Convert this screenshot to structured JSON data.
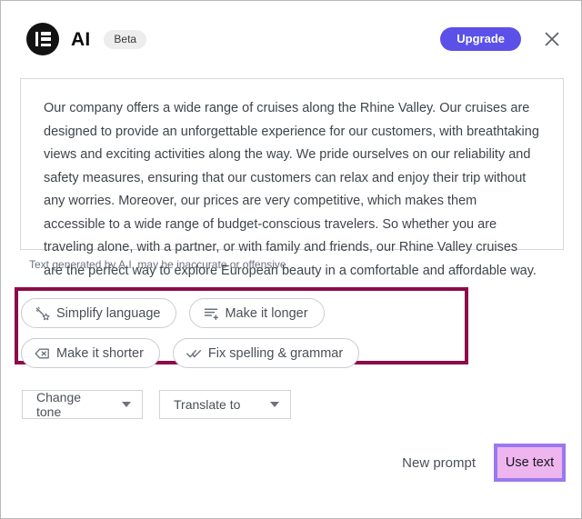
{
  "header": {
    "logo_icon": "elementor-logo-icon",
    "title": "AI",
    "badge": "Beta",
    "upgrade_label": "Upgrade",
    "close_icon": "close-icon"
  },
  "generated_text": {
    "body": "Our company offers a wide range of cruises along the Rhine Valley. Our cruises are designed to provide an unforgettable experience for our customers, with breathtaking views and exciting activities along the way. We pride ourselves on our reliability and safety measures, ensuring that our customers can relax and enjoy their trip without any worries. Moreover, our prices are very competitive, which makes them accessible to a wide range of budget-conscious travelers. So whether you are traveling alone, with a partner, or with family and friends, our Rhine Valley cruises are the perfect way to explore European beauty in a comfortable and affordable way.",
    "disclaimer": "Text generated by A.I. may be inaccurate or offensive."
  },
  "actions": {
    "chips": [
      {
        "label": "Simplify language",
        "icon": "magic-wand-icon"
      },
      {
        "label": "Make it longer",
        "icon": "add-lines-icon"
      },
      {
        "label": "Make it shorter",
        "icon": "backspace-icon"
      },
      {
        "label": "Fix spelling & grammar",
        "icon": "double-check-icon"
      }
    ],
    "highlight_color": "#8c0b48"
  },
  "dropdowns": [
    {
      "label": "Change tone",
      "icon": "chevron-down-icon"
    },
    {
      "label": "Translate to",
      "icon": "chevron-down-icon"
    }
  ],
  "footer": {
    "new_prompt_label": "New prompt",
    "use_text_label": "Use text",
    "use_text_highlight_border": "#9a79ef",
    "use_text_highlight_fill": "#efb5ef"
  },
  "colors": {
    "brand_accent": "#5b51e8",
    "logo_background": "#121212",
    "text_body": "#3f444b",
    "border_light": "#d5d8dc"
  }
}
